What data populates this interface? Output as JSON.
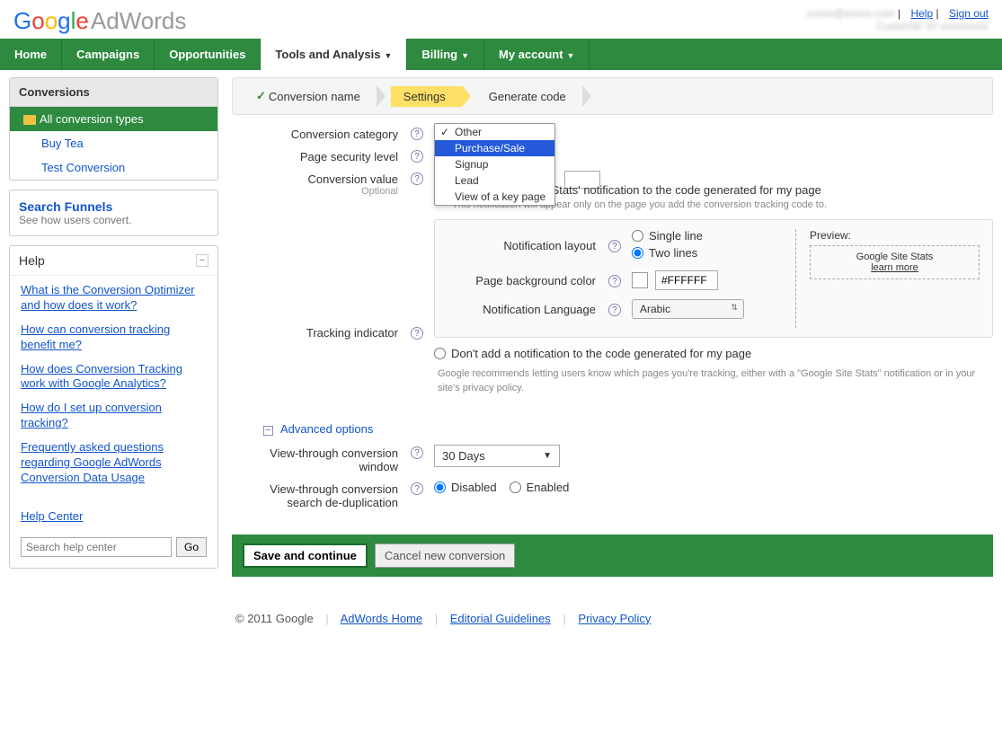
{
  "header": {
    "logo_adwords": "AdWords",
    "help_link": "Help",
    "signout_link": "Sign out",
    "blurred_email": "xxxxx@xxxxx.com",
    "blurred_customer": "Customer ID xxxxxxxxx"
  },
  "nav": {
    "tabs": [
      "Home",
      "Campaigns",
      "Opportunities",
      "Tools and Analysis",
      "Billing",
      "My account"
    ],
    "active_index": 3
  },
  "sidebar": {
    "conversions_header": "Conversions",
    "items": [
      "All conversion types",
      "Buy Tea",
      "Test Conversion"
    ],
    "funnels": {
      "title": "Search Funnels",
      "sub": "See how users convert."
    },
    "help": {
      "title": "Help",
      "links": [
        "What is the Conversion Optimizer and how does it work?",
        "How can conversion tracking benefit me?",
        "How does Conversion Tracking work with Google Analytics?",
        "How do I set up conversion tracking?",
        "Frequently asked questions regarding Google AdWords Conversion Data Usage"
      ],
      "help_center": "Help Center",
      "search_placeholder": "Search help center",
      "go": "Go"
    }
  },
  "breadcrumb": {
    "steps": [
      "Conversion name",
      "Settings",
      "Generate code"
    ]
  },
  "form": {
    "category_label": "Conversion category",
    "category_options": [
      "Other",
      "Purchase/Sale",
      "Signup",
      "Lead",
      "View of a key page"
    ],
    "category_selected": "Other",
    "category_highlighted": "Purchase/Sale",
    "security_label": "Page security level",
    "value_label": "Conversion value",
    "value_optional": "Optional",
    "tracking_label": "Tracking indicator",
    "add_notification": "Add a 'Google Site Stats' notification to the code generated for my page",
    "add_note_sub": "This notification will appear only on the page you add the conversion tracking code to.",
    "dont_add": "Don't add a notification to the code generated for my page",
    "dont_add_sub": "Google recommends letting users know which pages you're tracking, either with a \"Google Site Stats\" notification or in your site's privacy policy.",
    "notif": {
      "layout_label": "Notification layout",
      "single": "Single line",
      "two": "Two lines",
      "bg_label": "Page background color",
      "bg_value": "#FFFFFF",
      "lang_label": "Notification Language",
      "lang_value": "Arabic",
      "preview_label": "Preview:",
      "preview_text": "Google Site Stats",
      "preview_link": "learn more"
    },
    "advanced": {
      "title": "Advanced options",
      "vtc_window_label": "View-through conversion window",
      "vtc_window_value": "30 Days",
      "dedup_label": "View-through conversion search de-duplication",
      "disabled": "Disabled",
      "enabled": "Enabled"
    }
  },
  "actions": {
    "save": "Save and continue",
    "cancel": "Cancel new conversion"
  },
  "footer": {
    "copyright": "© 2011 Google",
    "links": [
      "AdWords Home",
      "Editorial Guidelines",
      "Privacy Policy"
    ]
  }
}
